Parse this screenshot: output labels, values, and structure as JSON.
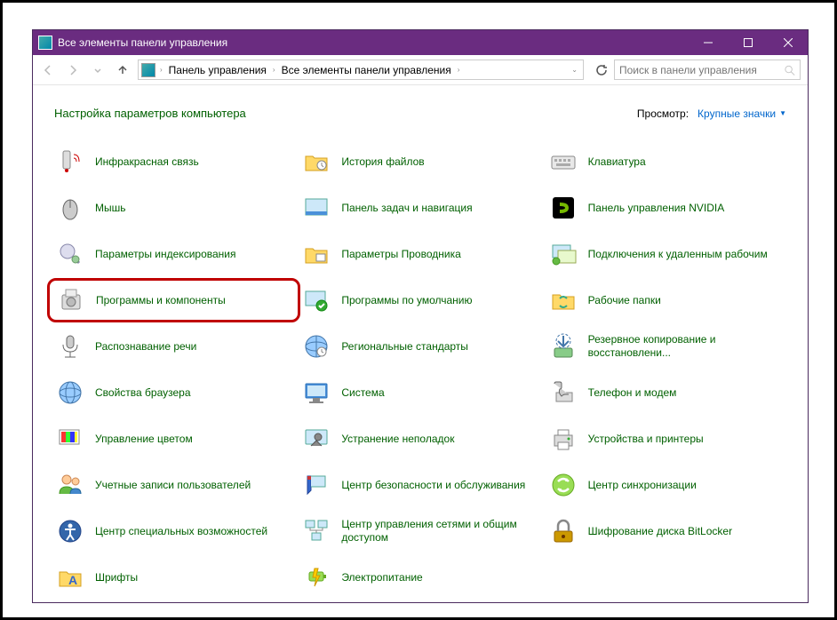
{
  "titlebar": {
    "title": "Все элементы панели управления"
  },
  "breadcrumbs": [
    "Панель управления",
    "Все элементы панели управления"
  ],
  "search": {
    "placeholder": "Поиск в панели управления"
  },
  "header": {
    "title": "Настройка параметров компьютера",
    "view_label": "Просмотр:",
    "view_mode": "Крупные значки"
  },
  "items": [
    {
      "label": "Инфракрасная связь",
      "icon": "infrared-icon"
    },
    {
      "label": "История файлов",
      "icon": "folder-history-icon"
    },
    {
      "label": "Клавиатура",
      "icon": "keyboard-icon"
    },
    {
      "label": "Мышь",
      "icon": "mouse-icon"
    },
    {
      "label": "Панель задач и навигация",
      "icon": "taskbar-icon"
    },
    {
      "label": "Панель управления NVIDIA",
      "icon": "nvidia-icon"
    },
    {
      "label": "Параметры индексирования",
      "icon": "indexing-icon"
    },
    {
      "label": "Параметры Проводника",
      "icon": "folder-options-icon"
    },
    {
      "label": "Подключения к удаленным рабочим",
      "icon": "remote-desktop-icon"
    },
    {
      "label": "Программы и компоненты",
      "icon": "programs-icon",
      "highlighted": true
    },
    {
      "label": "Программы по умолчанию",
      "icon": "default-programs-icon"
    },
    {
      "label": "Рабочие папки",
      "icon": "work-folders-icon"
    },
    {
      "label": "Распознавание речи",
      "icon": "speech-icon"
    },
    {
      "label": "Региональные стандарты",
      "icon": "region-icon"
    },
    {
      "label": "Резервное копирование и восстановлени...",
      "icon": "backup-icon"
    },
    {
      "label": "Свойства браузера",
      "icon": "internet-options-icon"
    },
    {
      "label": "Система",
      "icon": "system-icon"
    },
    {
      "label": "Телефон и модем",
      "icon": "phone-modem-icon"
    },
    {
      "label": "Управление цветом",
      "icon": "color-icon"
    },
    {
      "label": "Устранение неполадок",
      "icon": "troubleshoot-icon"
    },
    {
      "label": "Устройства и принтеры",
      "icon": "devices-printers-icon"
    },
    {
      "label": "Учетные записи пользователей",
      "icon": "user-accounts-icon"
    },
    {
      "label": "Центр безопасности и обслуживания",
      "icon": "security-icon"
    },
    {
      "label": "Центр синхронизации",
      "icon": "sync-icon"
    },
    {
      "label": "Центр специальных возможностей",
      "icon": "ease-access-icon"
    },
    {
      "label": "Центр управления сетями и общим доступом",
      "icon": "network-icon"
    },
    {
      "label": "Шифрование диска BitLocker",
      "icon": "bitlocker-icon"
    },
    {
      "label": "Шрифты",
      "icon": "fonts-icon"
    },
    {
      "label": "Электропитание",
      "icon": "power-icon"
    }
  ]
}
